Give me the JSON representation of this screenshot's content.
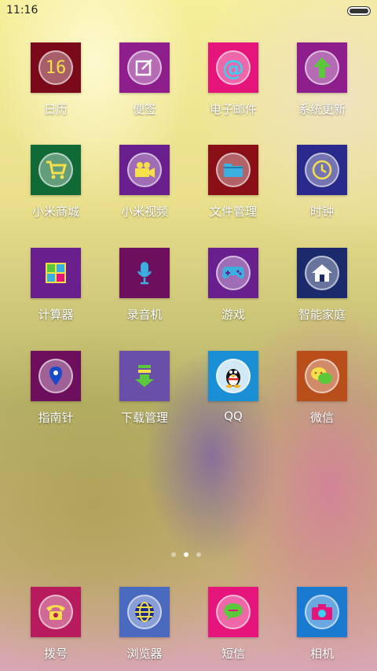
{
  "status_bar": {
    "time": "11:16",
    "battery_icon": "battery-icon"
  },
  "apps": [
    {
      "label": "日历",
      "icon": "calendar-icon",
      "icon_text": "16",
      "tile_color": "#7a0a1a",
      "ring": true
    },
    {
      "label": "便签",
      "icon": "notes-icon",
      "tile_color": "#8e1e8c",
      "ring": true
    },
    {
      "label": "电子邮件",
      "icon": "email-icon",
      "tile_color": "#e6157b",
      "ring": true
    },
    {
      "label": "系统更新",
      "icon": "update-arrow-icon",
      "tile_color": "#8e1e8c",
      "ring": true
    },
    {
      "label": "小米商城",
      "icon": "shopping-cart-icon",
      "tile_color": "#0f6a36",
      "ring": true
    },
    {
      "label": "小米视频",
      "icon": "video-camera-icon",
      "tile_color": "#6a1f8e",
      "ring": true
    },
    {
      "label": "文件管理",
      "icon": "folder-icon",
      "tile_color": "#8a0f16",
      "ring": true
    },
    {
      "label": "时钟",
      "icon": "clock-icon",
      "tile_color": "#2a2a8c",
      "ring": true
    },
    {
      "label": "计算器",
      "icon": "calculator-icon",
      "tile_color": "#6a1f8e",
      "ring": false
    },
    {
      "label": "录音机",
      "icon": "microphone-icon",
      "tile_color": "#6e0f5e",
      "ring": false
    },
    {
      "label": "游戏",
      "icon": "gamepad-icon",
      "tile_color": "#6a1f8e",
      "ring": true
    },
    {
      "label": "智能家庭",
      "icon": "home-icon",
      "tile_color": "#1a2a6a",
      "ring": true
    },
    {
      "label": "指南针",
      "icon": "location-pin-icon",
      "tile_color": "#6e0f5e",
      "ring": true
    },
    {
      "label": "下载管理",
      "icon": "download-icon",
      "tile_color": "#6a4fa8",
      "ring": false
    },
    {
      "label": "QQ",
      "icon": "qq-penguin-icon",
      "tile_color": "#1a8fd6",
      "ring": true
    },
    {
      "label": "微信",
      "icon": "chat-bubbles-icon",
      "tile_color": "#b84e1a",
      "ring": true
    }
  ],
  "page_indicator": {
    "count": 3,
    "active": 1
  },
  "dock": [
    {
      "label": "拨号",
      "icon": "phone-icon",
      "tile_color": "#b81a5e",
      "ring": true
    },
    {
      "label": "浏览器",
      "icon": "globe-icon",
      "tile_color": "#4a6ac0",
      "ring": true
    },
    {
      "label": "短信",
      "icon": "message-bubble-icon",
      "tile_color": "#e6157b",
      "ring": true
    },
    {
      "label": "相机",
      "icon": "camera-icon",
      "tile_color": "#1a7ad0",
      "ring": true
    }
  ]
}
